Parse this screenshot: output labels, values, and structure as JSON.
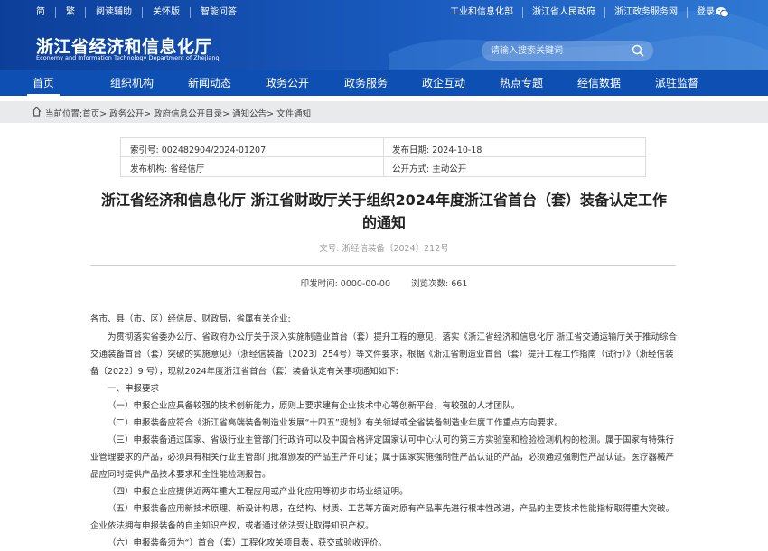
{
  "header": {
    "left_links": [
      "简",
      "繁",
      "阅读辅助",
      "关怀版",
      "智能问答"
    ],
    "right_links": [
      "工业和信息化部",
      "浙江省人民政府",
      "浙江政务服务网",
      "登录"
    ],
    "title": "浙江省经济和信息化厅",
    "subtitle": "Economy and Information Technology Department of Zhejiang",
    "search_placeholder": "请输入搜索关键词",
    "wechat_icon": "wechat-icon",
    "search_icon": "search-icon"
  },
  "nav": [
    "首页",
    "组织机构",
    "新闻动态",
    "政务公开",
    "政务服务",
    "政企互动",
    "热点专题",
    "经信数据",
    "派驻监督"
  ],
  "breadcrumb": {
    "icon": "home-icon",
    "items": [
      "当前位置:首页>",
      "政务公开>",
      "政府信息公开目录>",
      "通知公告>",
      "文件通知"
    ]
  },
  "meta": {
    "index_no": "索引号: 002482904/2024-01207",
    "pub_date": "发布日期: 2024-10-18",
    "issuer": "发布机构: 省经信厅",
    "disclosure": "公开方式: 主动公开"
  },
  "doc": {
    "title_line1": "浙江省经济和信息化厅 浙江省财政厅关于组织2024年度浙江省首台（套）装备认定工作",
    "title_line2": "的通知",
    "doc_no": "文号:  浙经信装备〔2024〕212号",
    "print_date": "印发时间:  0000-00-00",
    "views": "浏览次数:  661"
  },
  "body": {
    "salutation": "各市、县（市、区）经信局、财政局，省属有关企业:",
    "intro": "为贯彻落实省委办公厅、省政府办公厅关于深入实施制造业首台（套）提升工程的意见，落实《浙江省经济和信息化厅 浙江省交通运输厅关于推动综合交通装备首台（套）突破的实施意见》（浙经信装备〔2023〕254号）等文件要求，根据《浙江省制造业首台（套）提升工程工作指南（试行）》（浙经信装备〔2022〕9 号），现就2024年度浙江省首台（套）装备认定有关事项通知如下:",
    "section1": "一、申报要求",
    "items": [
      "（一）申报企业应具备较强的技术创新能力，原则上要求建有企业技术中心等创新平台，有较强的人才团队。",
      "（二）申报装备应符合《浙江省高端装备制造业发展“十四五”规划》有关领域或全省装备制造业年度工作重点方向要求。",
      "（三）申报装备通过国家、省级行业主管部门行政许可以及中国合格评定国家认可中心认可的第三方实验室和检验检测机构的检测。属于国家有特殊行业管理要求的产品，必须具有相关行业主管部门批准颁发的产品生产许可证；属于国家实施强制性产品认证的产品，必须通过强制性产品认证。医疗器械产品应同时提供产品技术要求和全性能检测报告。",
      "（四）申报企业应提供近两年重大工程应用或产业化应用等初步市场业绩证明。",
      "（五）申报装备应用新技术原理、新设计构思，在结构、材质、工艺等方面对原有产品率先进行根本性改进，产品的主要技术性能指标取得重大突破。企业依法拥有申报装备的自主知识产权，或者通过依法受让取得知识产权。",
      "（六）申报装备须为“）首台（套）工程化攻关项目表，获交或验收评价。"
    ]
  }
}
